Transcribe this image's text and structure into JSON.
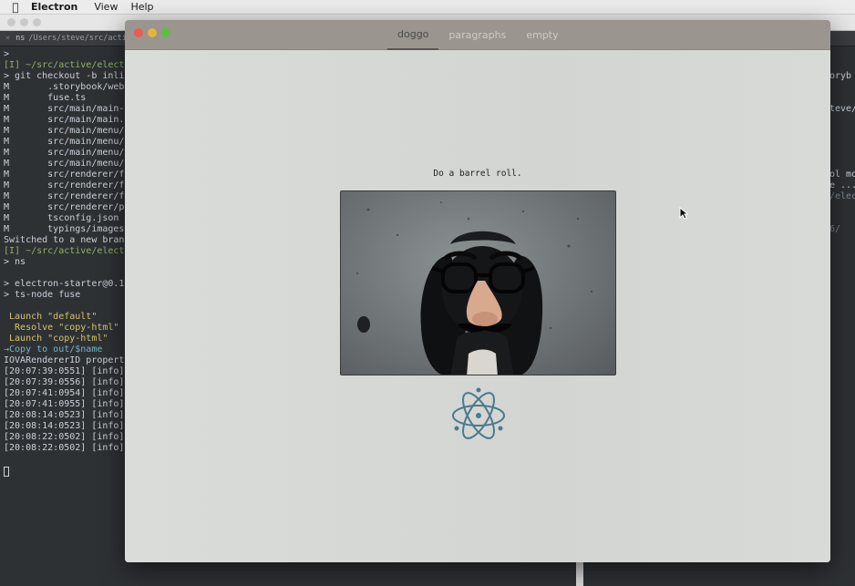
{
  "menubar": {
    "app_name": "Electron",
    "menus": [
      "View",
      "Help"
    ]
  },
  "terminal": {
    "tab_label": "ns",
    "tab_path": "/Users/steve/src/active/e",
    "lines": [
      {
        "text": ">",
        "style": "plain"
      },
      {
        "text": "[I] ~/src/active/elect",
        "style": "green"
      },
      {
        "text": "> git checkout -b inli",
        "style": "plain"
      },
      {
        "text": "M       .storybook/web",
        "style": "plain"
      },
      {
        "text": "M       fuse.ts",
        "style": "plain"
      },
      {
        "text": "M       src/main/main-",
        "style": "plain"
      },
      {
        "text": "M       src/main/main.",
        "style": "plain"
      },
      {
        "text": "M       src/main/menu/",
        "style": "plain"
      },
      {
        "text": "M       src/main/menu/",
        "style": "plain"
      },
      {
        "text": "M       src/main/menu/",
        "style": "plain"
      },
      {
        "text": "M       src/main/menu/",
        "style": "plain"
      },
      {
        "text": "M       src/renderer/f",
        "style": "plain"
      },
      {
        "text": "M       src/renderer/f",
        "style": "plain"
      },
      {
        "text": "M       src/renderer/f",
        "style": "plain"
      },
      {
        "text": "M       src/renderer/p",
        "style": "plain"
      },
      {
        "text": "M       tsconfig.json",
        "style": "plain"
      },
      {
        "text": "M       typings/images",
        "style": "plain"
      },
      {
        "text": "Switched to a new bran",
        "style": "plain"
      },
      {
        "text": "[I] ~/src/active/elect",
        "style": "green"
      },
      {
        "text": "> ns",
        "style": "plain"
      },
      {
        "text": "",
        "style": "plain"
      },
      {
        "text": "> electron-starter@0.1",
        "style": "plain"
      },
      {
        "text": "> ts-node fuse",
        "style": "plain"
      },
      {
        "text": "",
        "style": "plain"
      },
      {
        "text": " Launch \"default\"",
        "style": "yellow"
      },
      {
        "text": "  Resolve \"copy-html\"",
        "style": "yellow"
      },
      {
        "text": " Launch \"copy-html\"",
        "style": "yellow"
      },
      {
        "text": "→Copy to out/$name",
        "style": "cyan"
      },
      {
        "text": "IOVARendererID propert",
        "style": "plain"
      },
      {
        "text": "[20:07:39:0551] [info]",
        "style": "plain"
      },
      {
        "text": "[20:07:39:0556] [info]",
        "style": "plain"
      },
      {
        "text": "[20:07:41:0954] [info]",
        "style": "plain"
      },
      {
        "text": "[20:07:41:0955] [info]",
        "style": "plain"
      },
      {
        "text": "[20:08:14:0523] [info]",
        "style": "plain"
      },
      {
        "text": "[20:08:14:0523] [info]",
        "style": "plain"
      },
      {
        "text": "[20:08:22:0502] [info]",
        "style": "plain"
      },
      {
        "text": "[20:08:22:0502] [info]",
        "style": "plain"
      }
    ],
    "right_fragments": [
      {
        "text": "",
        "style": "plain"
      },
      {
        "text": "",
        "style": "plain"
      },
      {
        "text": "oryb",
        "style": "plain"
      },
      {
        "text": "",
        "style": "plain"
      },
      {
        "text": "",
        "style": "plain"
      },
      {
        "text": "teve/",
        "style": "plain"
      },
      {
        "text": "",
        "style": "plain"
      },
      {
        "text": "",
        "style": "plain"
      },
      {
        "text": "",
        "style": "plain"
      },
      {
        "text": "",
        "style": "plain"
      },
      {
        "text": "",
        "style": "plain"
      },
      {
        "text": "ol mo",
        "style": "plain"
      },
      {
        "text": "e ...",
        "style": "plain"
      },
      {
        "text": "/elec",
        "style": "dim"
      },
      {
        "text": "",
        "style": "plain"
      },
      {
        "text": "",
        "style": "plain"
      },
      {
        "text": "6/",
        "style": "dim"
      }
    ]
  },
  "app": {
    "tabs": [
      {
        "label": "doggo",
        "active": true
      },
      {
        "label": "paragraphs",
        "active": false
      },
      {
        "label": "empty",
        "active": false
      }
    ],
    "caption": "Do a barrel roll.",
    "logo_icon": "electron-atom-icon",
    "accent_color": "#4a7a8c"
  }
}
